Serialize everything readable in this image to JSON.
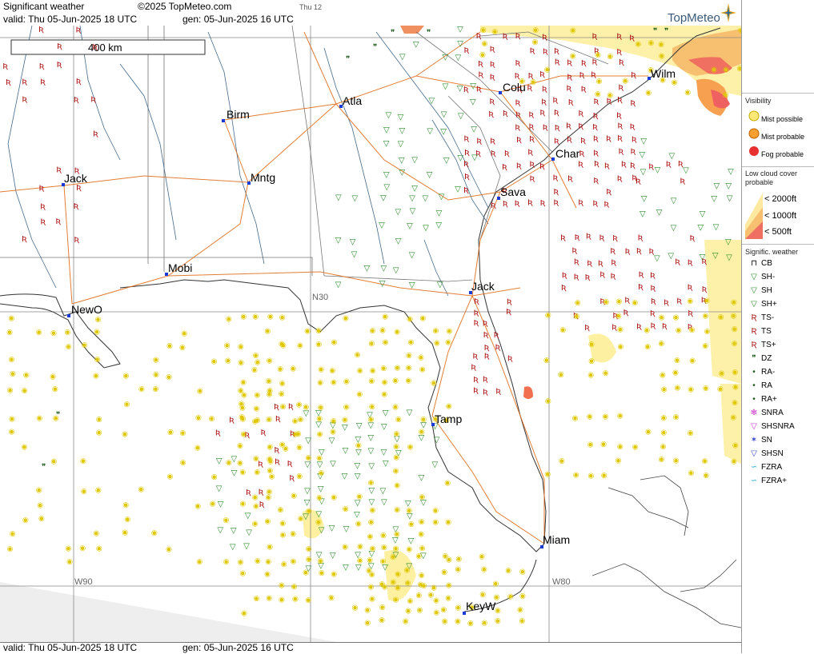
{
  "header": {
    "title": "Significant weather",
    "copyright": "©2025 TopMeteo.com",
    "weekday_small": "Thu 12",
    "valid_text": "valid:  Thu  05-Jun-2025  18 UTC",
    "gen_text": "gen: 05-Jun-2025 16 UTC",
    "logo": "TopMeteo"
  },
  "footer": {
    "valid_text": "valid:  Thu  05-Jun-2025  18 UTC",
    "gen_text": "gen: 05-Jun-2025 16 UTC"
  },
  "map": {
    "scale_label": "400 km",
    "gridlines": {
      "lon_labels": [
        "W90",
        "W80"
      ],
      "lat_labels": [
        "N30"
      ]
    },
    "cities": [
      {
        "name": "Birm"
      },
      {
        "name": "Atla"
      },
      {
        "name": "Colu"
      },
      {
        "name": "Wilm"
      },
      {
        "name": "Char"
      },
      {
        "name": "Jack"
      },
      {
        "name": "Mntg"
      },
      {
        "name": "Sava"
      },
      {
        "name": "Mobi"
      },
      {
        "name": "Jack"
      },
      {
        "name": "NewO"
      },
      {
        "name": "Tamp"
      },
      {
        "name": "Miam"
      },
      {
        "name": "KeyW"
      }
    ]
  },
  "legend": {
    "visibility_title": "Visibility",
    "visibility_items": [
      "Mist possible",
      "Mist probable",
      "Fog probable"
    ],
    "lowcloud_title": "Low cloud cover probable",
    "lowcloud_items": [
      "< 2000ft",
      "< 1000ft",
      "<  500ft"
    ],
    "sigwx_title": "Signific. weather",
    "sigwx_items": [
      {
        "label": "CB",
        "icon": "cb-icon",
        "color": "#000000"
      },
      {
        "label": "SH-",
        "icon": "triangle-down-icon",
        "color": "#2a8a2a"
      },
      {
        "label": "SH",
        "icon": "triangle-down-icon",
        "color": "#2a8a2a"
      },
      {
        "label": "SH+",
        "icon": "triangle-down-icon",
        "color": "#2a8a2a"
      },
      {
        "label": "TS-",
        "icon": "thunderstorm-icon",
        "color": "#aa1111"
      },
      {
        "label": "TS",
        "icon": "thunderstorm-icon",
        "color": "#aa1111"
      },
      {
        "label": "TS+",
        "icon": "thunderstorm-icon",
        "color": "#aa1111"
      },
      {
        "label": "DZ",
        "icon": "drizzle-icon",
        "color": "#1a5a1a"
      },
      {
        "label": "RA-",
        "icon": "rain-icon",
        "color": "#1a5a1a"
      },
      {
        "label": "RA",
        "icon": "rain-icon",
        "color": "#1a5a1a"
      },
      {
        "label": "RA+",
        "icon": "rain-icon",
        "color": "#1a5a1a"
      },
      {
        "label": "SNRA",
        "icon": "snow-rain-icon",
        "color": "#cc33cc"
      },
      {
        "label": "SHSNRA",
        "icon": "snow-rain-shower-icon",
        "color": "#cc33cc"
      },
      {
        "label": "SN",
        "icon": "snow-icon",
        "color": "#3344cc"
      },
      {
        "label": "SHSN",
        "icon": "snow-shower-icon",
        "color": "#3344cc"
      },
      {
        "label": "FZRA",
        "icon": "freezing-rain-icon",
        "color": "#22aacc"
      },
      {
        "label": "FZRA+",
        "icon": "freezing-rain-icon",
        "color": "#22aacc"
      }
    ]
  }
}
